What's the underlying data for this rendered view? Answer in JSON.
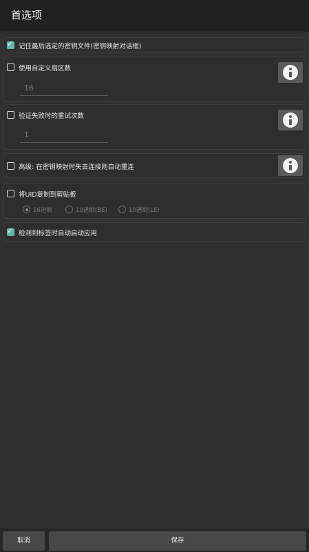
{
  "header": {
    "title": "首选项"
  },
  "options": {
    "remember_key_file": {
      "label": "记住最后选定的密钥文件(密钥映射对话框)",
      "checked": true
    },
    "custom_sectors": {
      "label": "使用自定义扇区数",
      "checked": false,
      "value": "16"
    },
    "retry_count": {
      "label": "验证失败时的重试次数",
      "checked": false,
      "value": "1"
    },
    "auto_reconnect": {
      "label": "高级: 在密钥映射时失去连接则自动重连",
      "checked": false
    },
    "copy_uid": {
      "label": "将UID复制到剪贴板",
      "checked": false,
      "formats": [
        "16进制",
        "10进制(BE)",
        "10进制(LE)"
      ],
      "selected_format": "16进制"
    },
    "auto_start": {
      "label": "检测到标签时自动启动应用",
      "checked": true
    }
  },
  "footer": {
    "cancel_label": "取消",
    "save_label": "保存"
  },
  "icons": {
    "checkbox_checked": "check-icon",
    "info": "info-icon"
  },
  "colors": {
    "accent": "#64b5b0",
    "background": "#303030",
    "header": "#212121",
    "button": "#484848"
  }
}
